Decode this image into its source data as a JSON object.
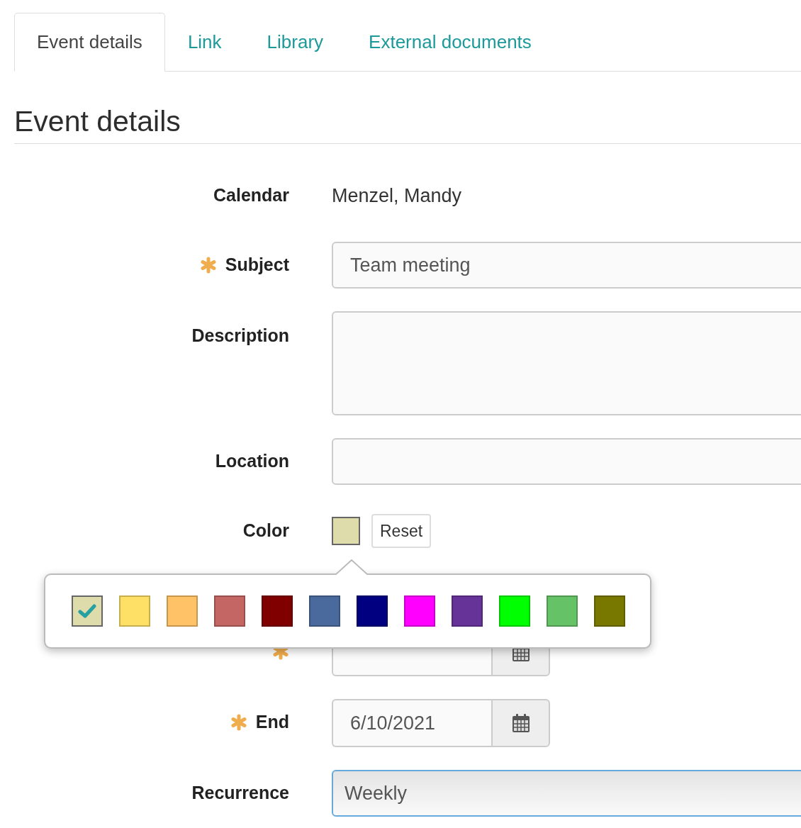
{
  "tabs": [
    {
      "label": "Event details",
      "selected": true
    },
    {
      "label": "Link",
      "selected": false
    },
    {
      "label": "Library",
      "selected": false
    },
    {
      "label": "External documents",
      "selected": false
    }
  ],
  "heading": "Event details",
  "fields": [
    {
      "kind": "text",
      "label": "Calendar",
      "required": false,
      "value": "Menzel, Mandy"
    },
    {
      "kind": "input",
      "label": "Subject",
      "required": true,
      "focused": false,
      "value": "Team meeting"
    },
    {
      "kind": "textarea",
      "label": "Description",
      "required": false,
      "focused": false
    },
    {
      "kind": "input",
      "label": "Location",
      "required": false,
      "focused": false
    },
    {
      "kind": "color",
      "label": "Color",
      "required": false,
      "color": "#dedcab",
      "reset": "Reset"
    },
    {
      "kind": "date",
      "required": true,
      "focused": false
    },
    {
      "kind": "date",
      "label": "End",
      "required": true,
      "focused": false,
      "value": "6/10/2021"
    },
    {
      "kind": "select",
      "label": "Recurrence",
      "required": false,
      "focused": true,
      "value": "Weekly"
    }
  ],
  "color_popover": {
    "swatches": [
      {
        "color": "#dedcab",
        "selected": true
      },
      {
        "color": "#ffe066",
        "selected": false
      },
      {
        "color": "#ffc266",
        "selected": false
      },
      {
        "color": "#c36664",
        "selected": false
      },
      {
        "color": "#800000",
        "selected": false
      },
      {
        "color": "#4a6a9e",
        "selected": false
      },
      {
        "color": "#000080",
        "selected": false
      },
      {
        "color": "#ff00ff",
        "selected": false
      },
      {
        "color": "#663399",
        "selected": false
      },
      {
        "color": "#00ff00",
        "selected": false
      },
      {
        "color": "#66c266",
        "selected": false
      },
      {
        "color": "#787800",
        "selected": false
      }
    ]
  }
}
